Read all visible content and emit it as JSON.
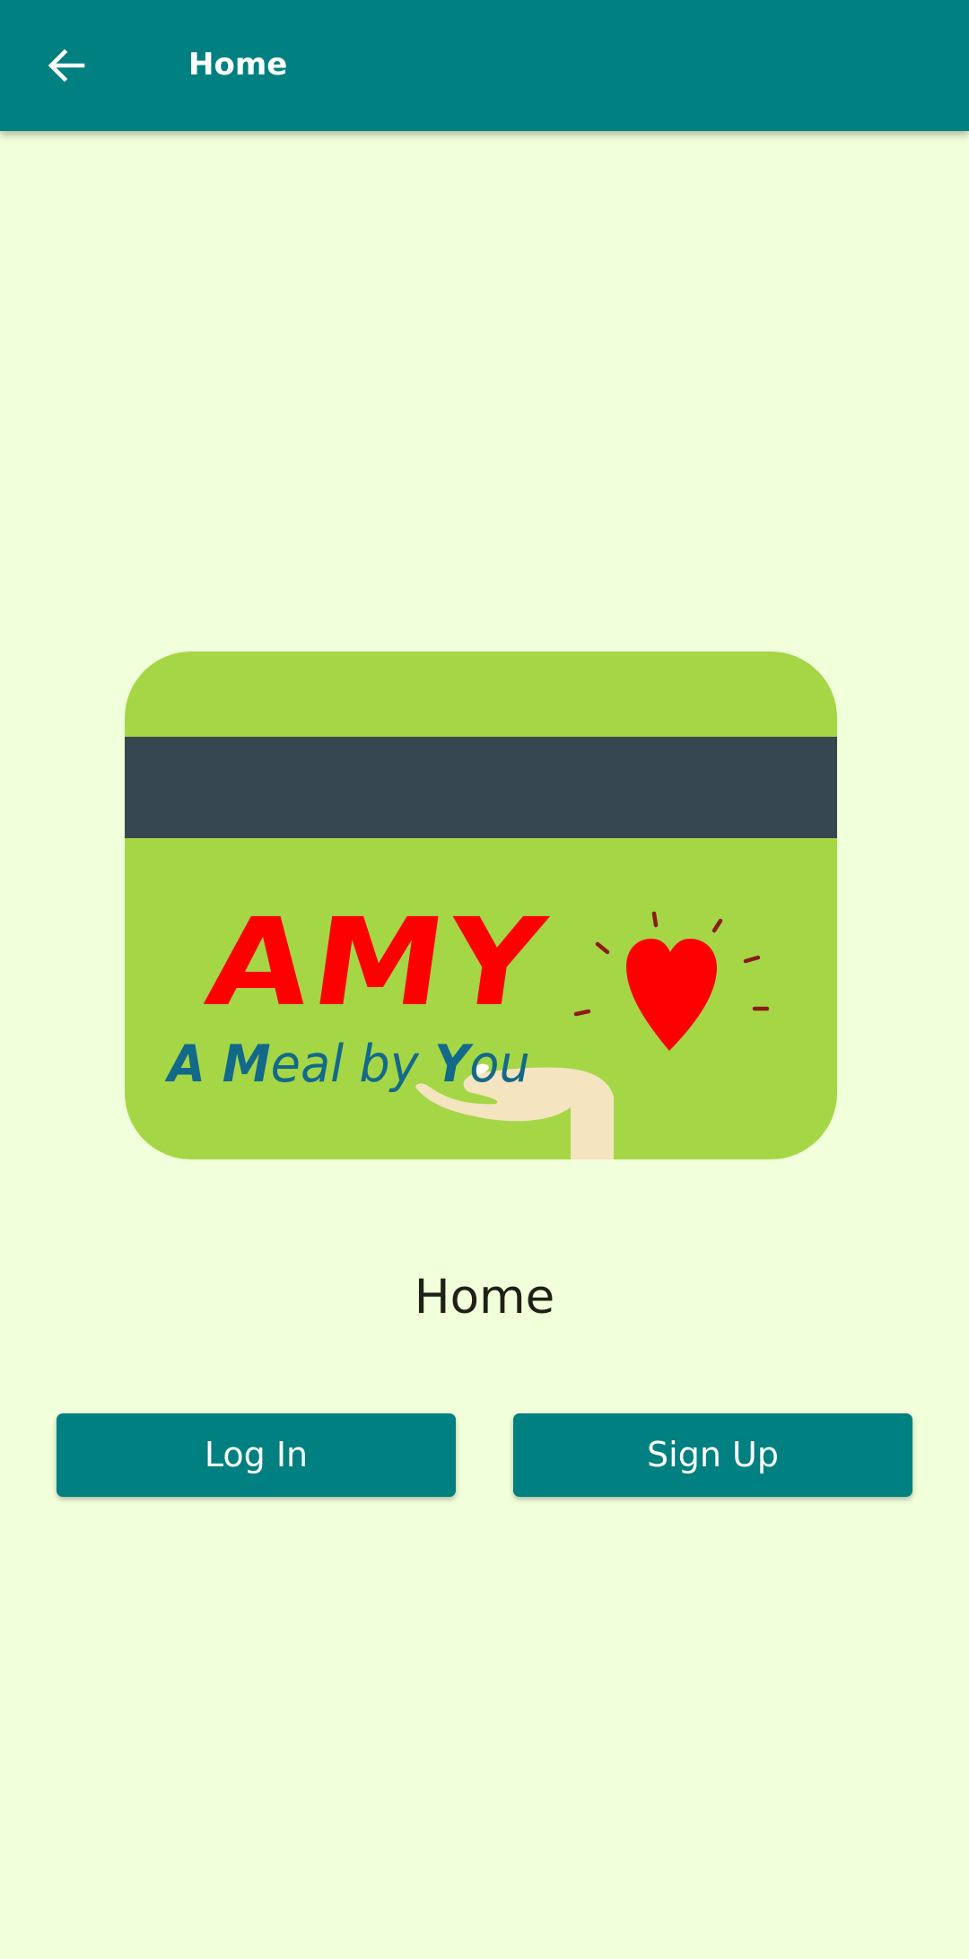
{
  "app_bar": {
    "back_icon": "arrow-left-icon",
    "title": "Home",
    "color": "#008080"
  },
  "logo": {
    "word": "AMY",
    "tagline_parts": [
      "A ",
      "M",
      "eal by ",
      "Y",
      "ou"
    ],
    "word_color": "#FF0000",
    "tagline_color": "#13698A",
    "card_color": "#A5D646",
    "stripe_color": "#36474F",
    "icons": [
      "heart-icon",
      "hand-icon"
    ]
  },
  "main": {
    "heading": "Home"
  },
  "buttons": {
    "login_label": "Log In",
    "signup_label": "Sign Up",
    "color": "#008080"
  },
  "background_color": "#F1FFDA"
}
